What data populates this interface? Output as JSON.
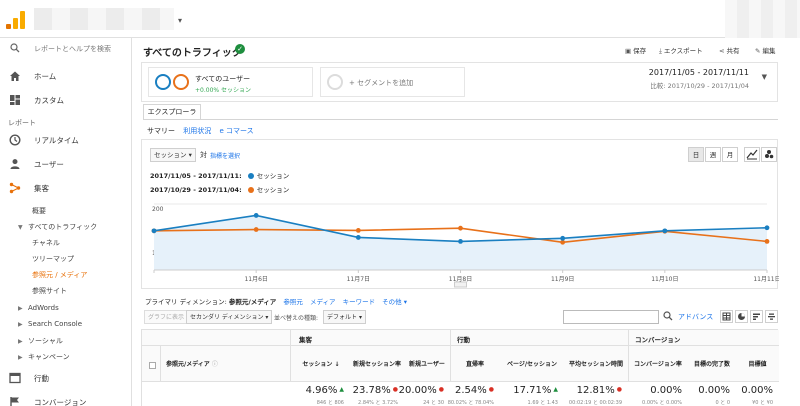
{
  "sidebar": {
    "search_label": "レポートとヘルプを検索",
    "items": [
      {
        "label": "ホーム"
      },
      {
        "label": "カスタム"
      }
    ],
    "section_label": "レポート",
    "reports": [
      {
        "label": "リアルタイム"
      },
      {
        "label": "ユーザー"
      },
      {
        "label": "集客"
      }
    ],
    "acq_children": [
      {
        "label": "概要"
      },
      {
        "label": "すべてのトラフィック"
      },
      {
        "label": "チャネル"
      },
      {
        "label": "ツリーマップ"
      },
      {
        "label": "参照元 / メディア"
      },
      {
        "label": "参照サイト"
      },
      {
        "label": "AdWords"
      },
      {
        "label": "Search Console"
      },
      {
        "label": "ソーシャル"
      },
      {
        "label": "キャンペーン"
      }
    ],
    "bottom_items": [
      {
        "label": "行動"
      },
      {
        "label": "コンバージョン"
      }
    ]
  },
  "header": {
    "title": "すべてのトラフィック",
    "save": "保存",
    "export": "エクスポート",
    "share": "共有",
    "edit": "編集"
  },
  "segments": {
    "name": "すべてのユーザー",
    "sub": "+0.00% セッション",
    "add_label": "+ セグメントを追加"
  },
  "dates": {
    "current": "2017/11/05 - 2017/11/11",
    "compare_prefix": "比較:",
    "compare": "2017/10/29 - 2017/11/04"
  },
  "tabs": {
    "explorer": "エクスプローラ",
    "sub": [
      "サマリー",
      "利用状況",
      "e コマース"
    ]
  },
  "chart_controls": {
    "metric": "セッション",
    "vs": "対",
    "pick": "指標を選択",
    "gran_day": "日",
    "gran_week": "週",
    "gran_month": "月"
  },
  "chart_data": {
    "type": "line",
    "x": [
      "",
      "11月6日",
      "11月7日",
      "11月8日",
      "11月9日",
      "11月10日",
      "11月11日"
    ],
    "yticks": [
      100,
      200
    ],
    "series": [
      {
        "name": "セッション",
        "period": "2017/11/05 - 2017/11/11:",
        "color": "#1a7fc1",
        "values": [
          139,
          174,
          124,
          115,
          122,
          139,
          146
        ]
      },
      {
        "name": "セッション",
        "period": "2017/10/29 - 2017/11/04:",
        "color": "#e8711a",
        "values": [
          139,
          142,
          140,
          145,
          113,
          138,
          115
        ]
      }
    ]
  },
  "dimensions": {
    "primary_label": "プライマリ ディメンション:",
    "current": "参照元/メディア",
    "links": [
      "参照元",
      "メディア",
      "キーワード",
      "その他"
    ]
  },
  "table_controls": {
    "plot_rows": "グラフに表示",
    "secondary": "セカンダリ ディメンション",
    "sort_label": "並べ替えの種類:",
    "sort_value": "デフォルト",
    "advanced": "アドバンス"
  },
  "table": {
    "groups": [
      "集客",
      "行動",
      "コンバージョン"
    ],
    "dim_header": "参照元/メディア",
    "columns": [
      "セッション",
      "新規セッション率",
      "新規ユーザー",
      "直帰率",
      "ページ/セッション",
      "平均セッション時間",
      "コンバージョン率",
      "目標の完了数",
      "目標値"
    ],
    "totals": [
      {
        "value": "4.96%",
        "arrow": "▲",
        "arrow_color": "#1e8e3e",
        "cmp": "846 と 806"
      },
      {
        "value": "23.78%",
        "arrow": "●",
        "arrow_color": "#d93025",
        "cmp": "2.84% と 3.72%"
      },
      {
        "value": "20.00%",
        "arrow": "●",
        "arrow_color": "#d93025",
        "cmp": "24 と 30"
      },
      {
        "value": "2.54%",
        "arrow": "●",
        "arrow_color": "#d93025",
        "cmp": "80.02% と 78.04%"
      },
      {
        "value": "17.71%",
        "arrow": "▲",
        "arrow_color": "#1e8e3e",
        "cmp": "1.69 と 1.43"
      },
      {
        "value": "12.81%",
        "arrow": "●",
        "arrow_color": "#d93025",
        "cmp": "00:02:19 と 00:02:39"
      },
      {
        "value": "0.00%",
        "arrow": "",
        "arrow_color": "",
        "cmp": "0.00% と 0.00%"
      },
      {
        "value": "0.00%",
        "arrow": "",
        "arrow_color": "",
        "cmp": "0 と 0"
      },
      {
        "value": "0.00%",
        "arrow": "",
        "arrow_color": "",
        "cmp": "¥0 と ¥0"
      }
    ]
  }
}
